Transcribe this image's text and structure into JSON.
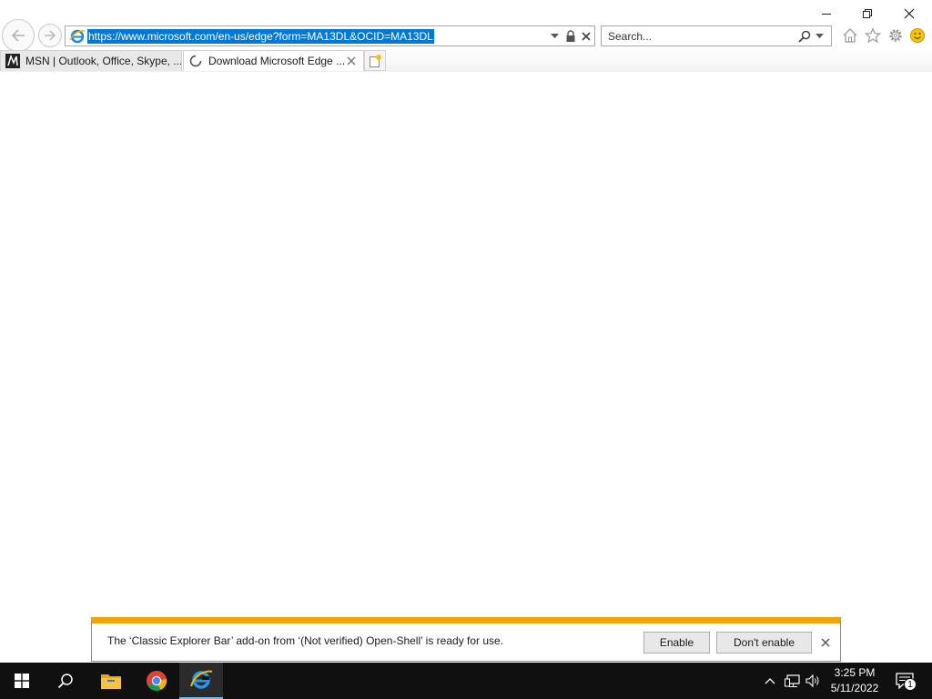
{
  "browser": {
    "address_url": "https://www.microsoft.com/en-us/edge?form=MA13DL&OCID=MA13DL",
    "search_placeholder": "Search...",
    "tabs": [
      {
        "label": "MSN | Outlook, Office, Skype, ..."
      },
      {
        "label": "Download Microsoft Edge ..."
      }
    ]
  },
  "notification": {
    "message": "The ‘Classic Explorer Bar’ add-on from ‘(Not verified) Open-Shell’ is ready for use.",
    "enable_label": "Enable",
    "dont_enable_label": "Don't enable"
  },
  "taskbar": {
    "time": "3:25 PM",
    "date": "5/11/2022",
    "notification_count": "1"
  },
  "colors": {
    "selection": "#0078d7",
    "notify_accent": "#f0a30a",
    "taskbar": "#101010"
  }
}
